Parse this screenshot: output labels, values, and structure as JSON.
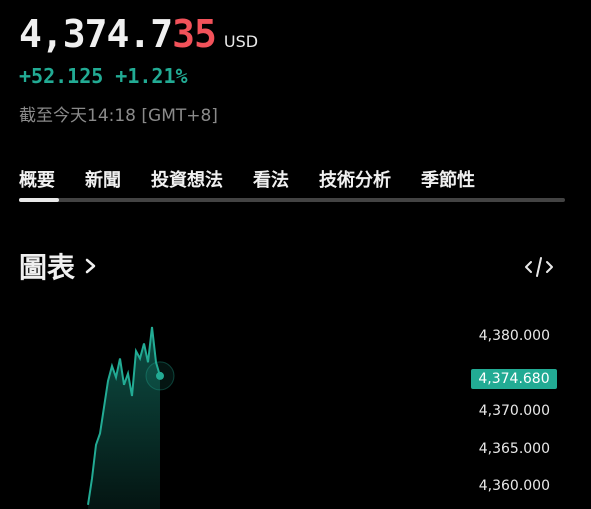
{
  "quote": {
    "price_main": "4,374.7",
    "price_tail": "35",
    "currency": "USD",
    "change_abs": "+52.125",
    "change_pct": "+1.21%",
    "as_of": "截至今天14:18 [GMT+8]"
  },
  "tabs": [
    {
      "label": "概要",
      "active": true
    },
    {
      "label": "新聞"
    },
    {
      "label": "投資想法"
    },
    {
      "label": "看法"
    },
    {
      "label": "技術分析"
    },
    {
      "label": "季節性"
    }
  ],
  "chart_section": {
    "title": "圖表",
    "embed_icon": "code-embed-icon",
    "chevron_icon": "chevron-right-icon"
  },
  "chart_data": {
    "type": "area",
    "y_ticks": [
      "4,380.000",
      "4,370.000",
      "4,365.000",
      "4,360.000"
    ],
    "last_price_label": "4,374.680",
    "y_values": [
      4357.5,
      4361.0,
      4365.5,
      4367.0,
      4370.5,
      4374.0,
      4376.0,
      4374.5,
      4377.0,
      4373.5,
      4375.0,
      4372.0,
      4378.0,
      4377.0,
      4379.0,
      4376.5,
      4381.2,
      4376.5,
      4374.68
    ],
    "ylim": [
      4356.8,
      4382.0
    ],
    "colors": {
      "line": "#22ab94",
      "fill_top": "#0d4f45",
      "fill_bottom": "#041512",
      "accent_up": "#22ab94",
      "accent_tail": "#f2525a"
    }
  }
}
